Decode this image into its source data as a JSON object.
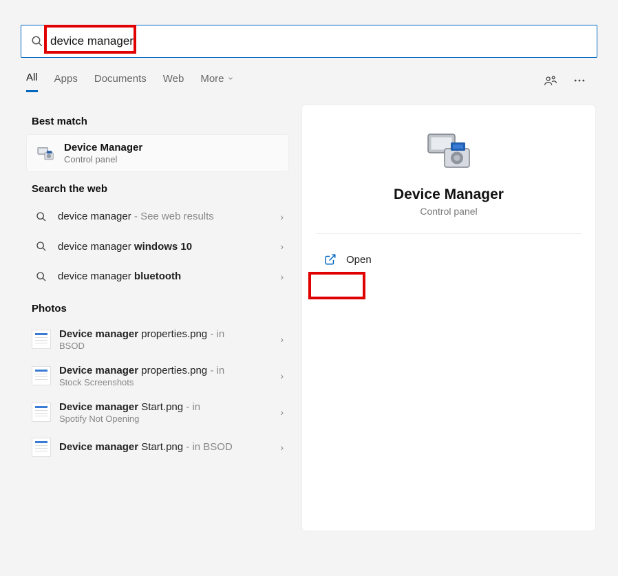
{
  "search": {
    "value": "device manager"
  },
  "tabs": {
    "all": "All",
    "apps": "Apps",
    "documents": "Documents",
    "web": "Web",
    "more": "More"
  },
  "sections": {
    "best": "Best match",
    "web": "Search the web",
    "photos": "Photos"
  },
  "best_match": {
    "title": "Device Manager",
    "subtitle": "Control panel"
  },
  "web_results": [
    {
      "prefix": "device manager",
      "bold": "",
      "suffix": " - See web results"
    },
    {
      "prefix": "device manager ",
      "bold": "windows 10",
      "suffix": ""
    },
    {
      "prefix": "device manager ",
      "bold": "bluetooth",
      "suffix": ""
    }
  ],
  "photos": [
    {
      "name_bold": "Device manager",
      "name_rest": " properties.png",
      "suffix": " - in",
      "sub": "BSOD"
    },
    {
      "name_bold": "Device manager",
      "name_rest": " properties.png",
      "suffix": " - in",
      "sub": "Stock Screenshots"
    },
    {
      "name_bold": "Device manager",
      "name_rest": " Start.png",
      "suffix": " - in",
      "sub": "Spotify Not Opening"
    },
    {
      "name_bold": "Device manager",
      "name_rest": " Start.png",
      "suffix": " - in BSOD",
      "sub": ""
    }
  ],
  "detail": {
    "title": "Device Manager",
    "subtitle": "Control panel",
    "open": "Open"
  }
}
